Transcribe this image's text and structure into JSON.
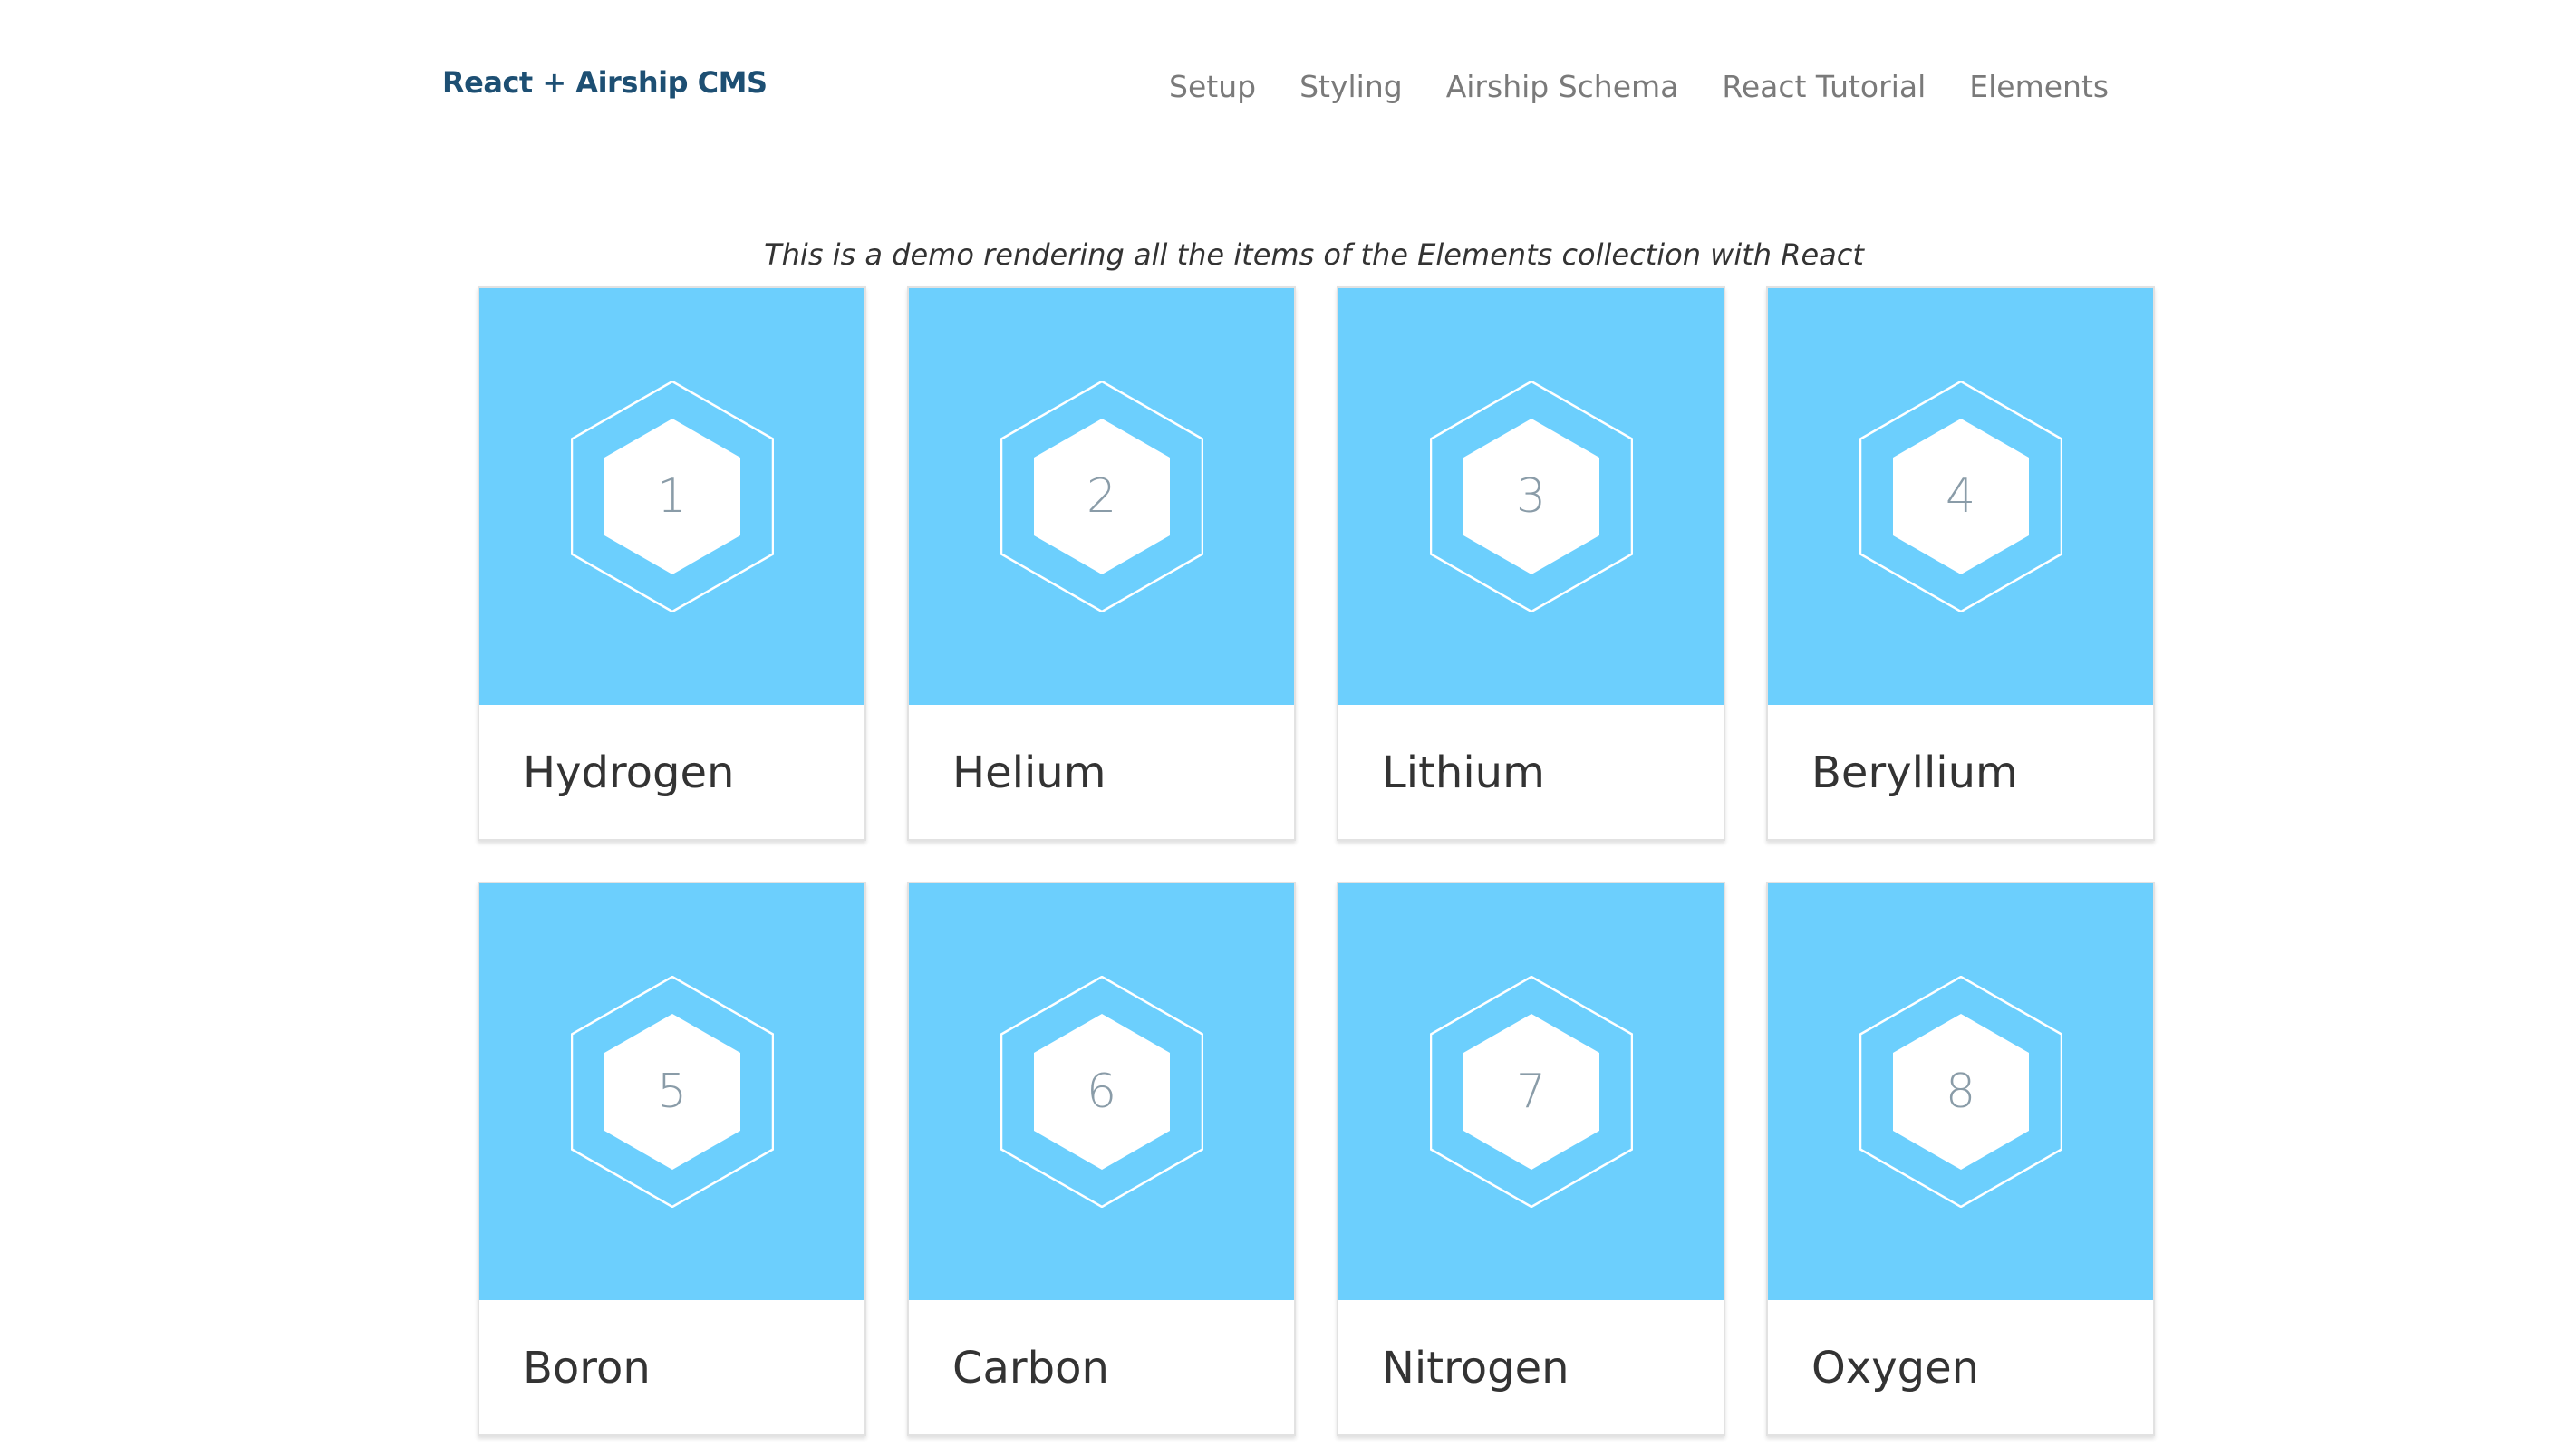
{
  "header": {
    "brand": "React + Airship CMS",
    "nav": [
      {
        "label": "Setup"
      },
      {
        "label": "Styling"
      },
      {
        "label": "Airship Schema"
      },
      {
        "label": "React Tutorial"
      },
      {
        "label": "Elements"
      }
    ]
  },
  "intro": "This is a demo rendering all the items of the Elements collection with React",
  "colors": {
    "card_media": "#6ccffd",
    "brand": "#1d4f73",
    "nav": "#7a7a7a"
  },
  "elements": [
    {
      "number": "1",
      "name": "Hydrogen",
      "icon": "hexagon-icon"
    },
    {
      "number": "2",
      "name": "Helium",
      "icon": "hexagon-icon"
    },
    {
      "number": "3",
      "name": "Lithium",
      "icon": "hexagon-icon"
    },
    {
      "number": "4",
      "name": "Beryllium",
      "icon": "hexagon-icon"
    },
    {
      "number": "5",
      "name": "Boron",
      "icon": "hexagon-icon"
    },
    {
      "number": "6",
      "name": "Carbon",
      "icon": "hexagon-icon"
    },
    {
      "number": "7",
      "name": "Nitrogen",
      "icon": "hexagon-icon"
    },
    {
      "number": "8",
      "name": "Oxygen",
      "icon": "hexagon-icon"
    }
  ]
}
